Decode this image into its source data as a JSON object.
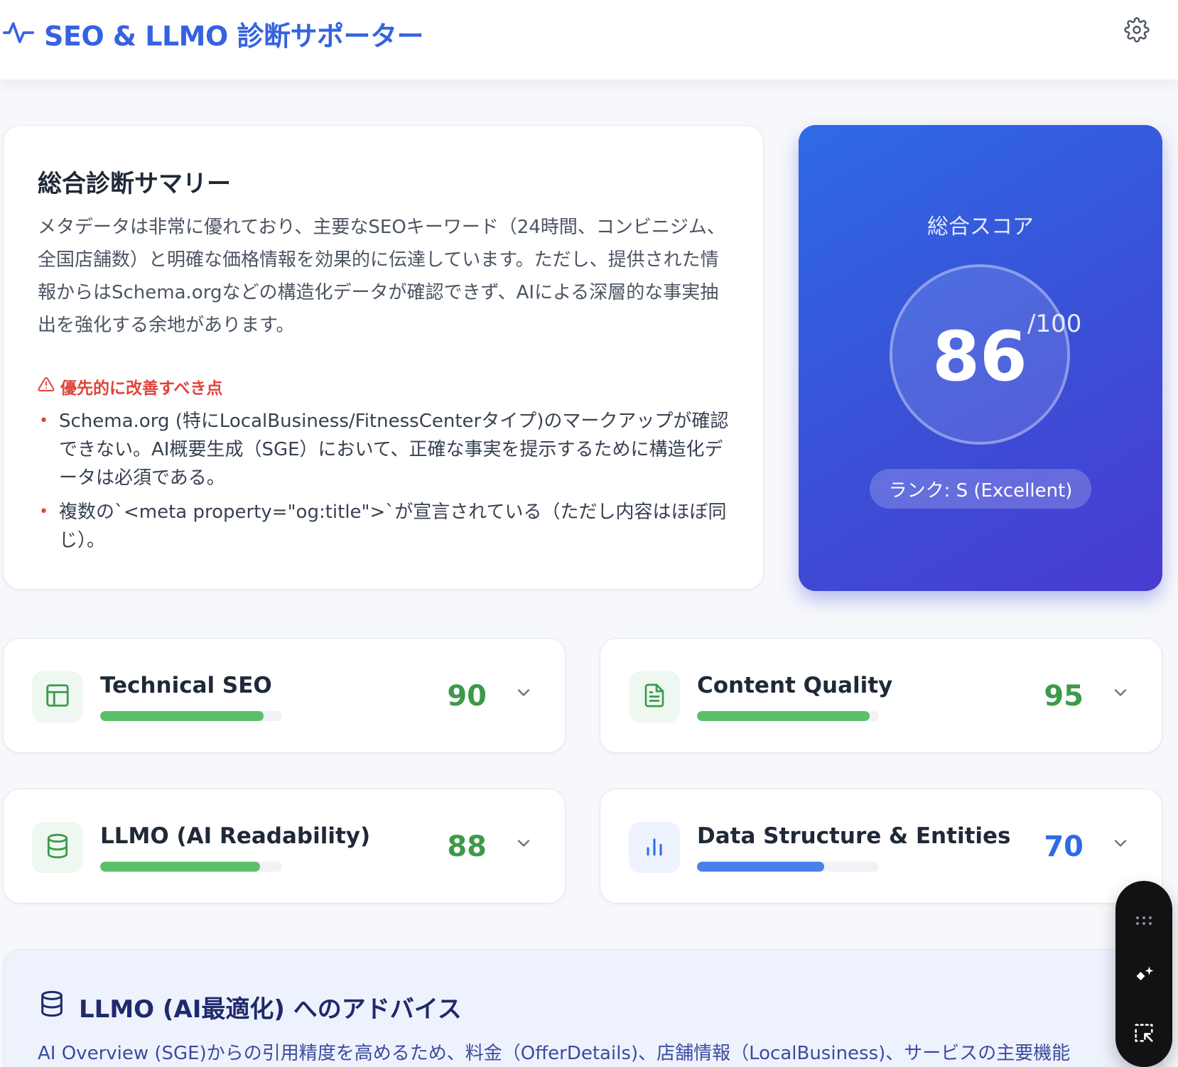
{
  "header": {
    "title": "SEO & LLMO 診断サポーター",
    "logo_icon": "activity-pulse-icon",
    "settings_icon": "gear-icon"
  },
  "summary": {
    "title": "総合診断サマリー",
    "text": "メタデータは非常に優れており、主要なSEOキーワード（24時間、コンビニジム、全国店舗数）と明確な価格情報を効果的に伝達しています。ただし、提供された情報からはSchema.orgなどの構造化データが確認できず、AIによる深層的な事実抽出を強化する余地があります。",
    "priority_title": "優先的に改善すべき点",
    "priority_items": [
      "Schema.org (特にLocalBusiness/FitnessCenterタイプ)のマークアップが確認できない。AI概要生成（SGE）において、正確な事実を提示するために構造化データは必須である。",
      "複数の`<meta property=\"og:title\">`が宣言されている（ただし内容はほぼ同じ）。"
    ]
  },
  "score": {
    "label": "総合スコア",
    "value": "86",
    "max": "/100",
    "rank": "ランク: S (Excellent)"
  },
  "metrics": [
    {
      "title": "Technical SEO",
      "score": "90",
      "progress": 0.9,
      "color": "#3d9a4b",
      "bar_color": "#5cc06a",
      "icon": "layout-icon",
      "icon_bg": "#eef8f0"
    },
    {
      "title": "Content Quality",
      "score": "95",
      "progress": 0.95,
      "color": "#3d9a4b",
      "bar_color": "#5cc06a",
      "icon": "document-icon",
      "icon_bg": "#eef8f0"
    },
    {
      "title": "LLMO (AI Readability)",
      "score": "88",
      "progress": 0.88,
      "color": "#3d9a4b",
      "bar_color": "#5cc06a",
      "icon": "database-icon",
      "icon_bg": "#eef8f0"
    },
    {
      "title": "Data Structure & Entities",
      "score": "70",
      "progress": 0.7,
      "color": "#2f6ae6",
      "bar_color": "#4b80ea",
      "icon": "bar-chart-icon",
      "icon_bg": "#eef3fd"
    }
  ],
  "advice": {
    "title": "LLMO (AI最適化) へのアドバイス",
    "text": "AI Overview (SGE)からの引用精度を高めるため、料金（OfferDetails)、店舗情報（LocalBusiness)、サービスの主要機能"
  },
  "floating_toolbar": {
    "icons": [
      "drag-handle-icon",
      "sparkle-icon",
      "select-cursor-icon"
    ]
  }
}
